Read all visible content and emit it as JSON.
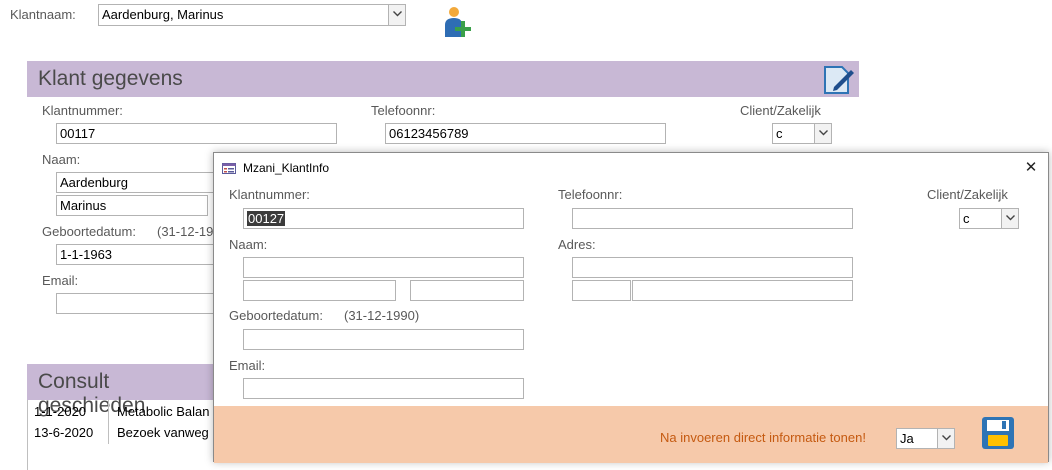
{
  "top": {
    "klantnaam_label": "Klantnaam:",
    "klantnaam_value": "Aardenburg, Marinus",
    "add_client_icon": "add-person-icon"
  },
  "klant": {
    "header": "Klant gegevens",
    "edit_icon": "edit-document-icon",
    "klantnummer_label": "Klantnummer:",
    "klantnummer": "00117",
    "telefoon_label": "Telefoonnr:",
    "telefoon": "06123456789",
    "client_label": "Client/Zakelijk",
    "client_value": "c",
    "naam_label": "Naam:",
    "achternaam": "Aardenburg",
    "voornaam": "Marinus",
    "geboorte_label": "Geboortedatum:",
    "geboorte_hint": "(31-12-19",
    "geboortedatum": "1-1-1963",
    "email_label": "Email:",
    "email": ""
  },
  "consult": {
    "header": "Consult geschieden",
    "rows": [
      {
        "date": "1-1-2020",
        "desc": "Metabolic Balan"
      },
      {
        "date": "13-6-2020",
        "desc": "Bezoek vanweg"
      }
    ]
  },
  "dialog": {
    "title": "Mzani_KlantInfo",
    "close": "✕",
    "klantnummer_label": "Klantnummer:",
    "klantnummer": "00127",
    "telefoon_label": "Telefoonnr:",
    "telefoon": "",
    "client_label": "Client/Zakelijk",
    "client_value": "c",
    "naam_label": "Naam:",
    "adres_label": "Adres:",
    "geboorte_label": "Geboortedatum:",
    "geboorte_hint": "(31-12-1990)",
    "email_label": "Email:",
    "footer_text": "Na invoeren direct informatie tonen!",
    "footer_select": "Ja",
    "save_icon": "save-icon"
  },
  "colors": {
    "section_header": "#c8b8d5",
    "footer_bg": "#f6c9aa",
    "footer_text": "#c55a11",
    "save_icon": "#2e74b5",
    "save_icon_accent": "#ffc000"
  }
}
